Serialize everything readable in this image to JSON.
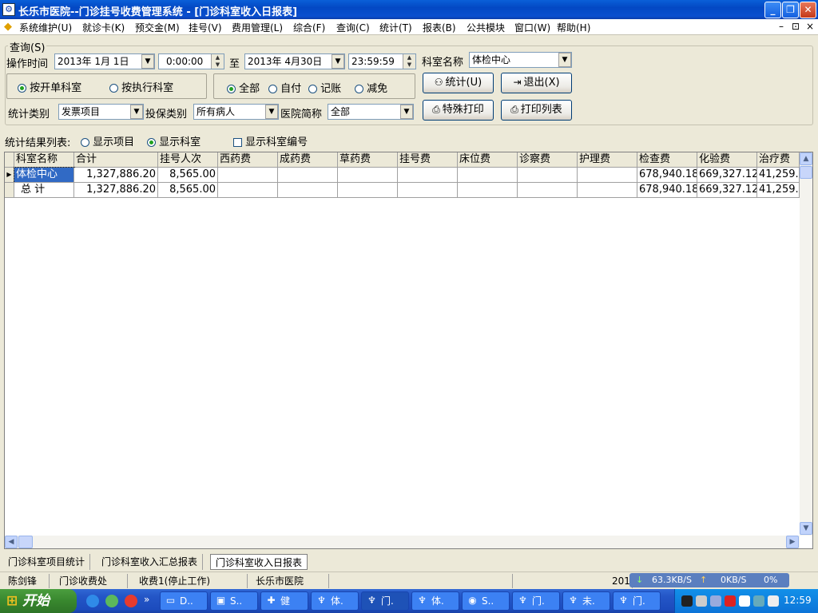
{
  "window": {
    "title": "长乐市医院--门诊挂号收费管理系统 - [门诊科室收入日报表]",
    "icon": "app-icon",
    "controls": [
      "minimize-icon",
      "restore-icon",
      "close-icon"
    ]
  },
  "menu": {
    "items": [
      "系统维护(U)",
      "就诊卡(K)",
      "预交金(M)",
      "挂号(V)",
      "费用管理(L)",
      "综合(F)",
      "查询(C)",
      "统计(T)",
      "报表(B)",
      "公共模块",
      "窗口(W)",
      "帮助(H)"
    ],
    "mdi_controls": [
      "–",
      "⊡",
      "×"
    ]
  },
  "query": {
    "group_title": "查询(S)",
    "time_label": "操作时间",
    "start_date": "2013年 1月 1日",
    "start_time": "0:00:00",
    "to_label": "至",
    "end_date": "2013年 4月30日",
    "end_time": "23:59:59",
    "dept_label": "科室名称",
    "dept_value": "体检中心",
    "mode_options": [
      "按开单科室",
      "按执行科室"
    ],
    "mode_selected": 0,
    "pay_options": [
      "全部",
      "自付",
      "记账",
      "减免"
    ],
    "pay_selected": 0,
    "stat_type_label": "统计类别",
    "stat_type_value": "发票项目",
    "insure_label": "投保类别",
    "insure_value": "所有病人",
    "hospital_label": "医院简称",
    "hospital_value": "全部",
    "btn_stat": "统计(U)",
    "btn_exit": "退出(X)",
    "btn_special_print": "特殊打印",
    "btn_print_list": "打印列表"
  },
  "result_options": {
    "label": "统计结果列表:",
    "show_item": "显示项目",
    "show_dept": "显示科室",
    "show_dept_selected": true,
    "show_dept_code": "显示科室编号",
    "show_dept_code_checked": false
  },
  "table": {
    "columns": [
      "科室名称",
      "合计",
      "挂号人次",
      "西药费",
      "成药费",
      "草药费",
      "挂号费",
      "床位费",
      "诊察费",
      "护理费",
      "检查费",
      "化验费",
      "治疗费"
    ],
    "rows": [
      [
        "体检中心",
        "1,327,886.20",
        "8,565.00",
        "",
        "",
        "",
        "",
        "",
        "",
        "",
        "678,940.18",
        "669,327.12",
        "41,259."
      ],
      [
        "总 计",
        "1,327,886.20",
        "8,565.00",
        "",
        "",
        "",
        "",
        "",
        "",
        "",
        "678,940.18",
        "669,327.12",
        "41,259."
      ]
    ]
  },
  "tabs": [
    "门诊科室项目统计",
    "门诊科室收入汇总报表",
    "门诊科室收入日报表"
  ],
  "active_tab": 2,
  "status": {
    "user": "陈剑锋",
    "dept": "门诊收费处",
    "station": "收费1(停止工作)",
    "hospital": "长乐市医院",
    "date_partial": "201"
  },
  "netmon": {
    "down": "63.3KB/S",
    "up": "0KB/S",
    "cpu": "0%"
  },
  "taskbar": {
    "start_label": "开始",
    "items": [
      "D..",
      "S..",
      "健",
      "体.",
      "门.",
      "体.",
      "S..",
      "门.",
      "未.",
      "门."
    ],
    "active_item": 4,
    "clock": "12:59"
  },
  "colors": {
    "selection": "#316ac5",
    "titlebar": "#0a4fcf",
    "window_bg": "#ece9d8"
  }
}
